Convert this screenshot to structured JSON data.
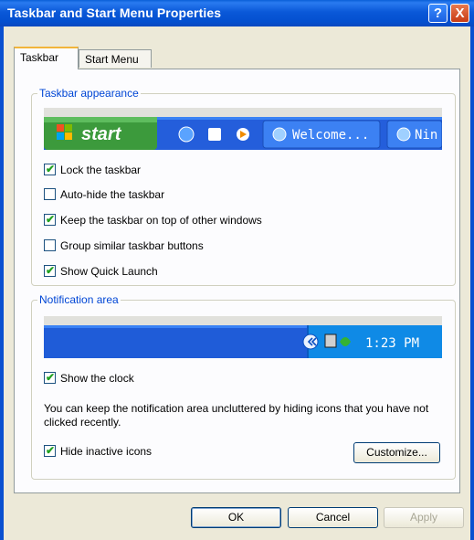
{
  "window": {
    "title": "Taskbar and Start Menu Properties"
  },
  "title_buttons": {
    "help": "?",
    "close": "X"
  },
  "tabs": [
    {
      "label": "Taskbar"
    },
    {
      "label": "Start Menu"
    }
  ],
  "taskbar_appearance": {
    "heading": "Taskbar appearance",
    "preview": {
      "start_label": "start",
      "buttons": [
        "Welcome...",
        "Nin"
      ]
    },
    "options": [
      {
        "label": "Lock the taskbar",
        "checked": true
      },
      {
        "label": "Auto-hide the taskbar",
        "checked": false
      },
      {
        "label": "Keep the taskbar on top of other windows",
        "checked": true
      },
      {
        "label": "Group similar taskbar buttons",
        "checked": false
      },
      {
        "label": "Show Quick Launch",
        "checked": true
      }
    ]
  },
  "notification_area": {
    "heading": "Notification area",
    "preview_time": "1:23 PM",
    "show_clock": {
      "label": "Show the clock",
      "checked": true
    },
    "description": "You can keep the notification area uncluttered by hiding icons that you have not clicked recently.",
    "hide_inactive": {
      "label": "Hide inactive icons",
      "checked": true
    },
    "customize_label": "Customize..."
  },
  "footer": {
    "ok": "OK",
    "cancel": "Cancel",
    "apply": "Apply"
  },
  "colors": {
    "title_blue": "#0a58d8",
    "group_label": "#0046d5",
    "start_green": "#3c9a3c",
    "taskbar_blue": "#1f5cd8"
  }
}
